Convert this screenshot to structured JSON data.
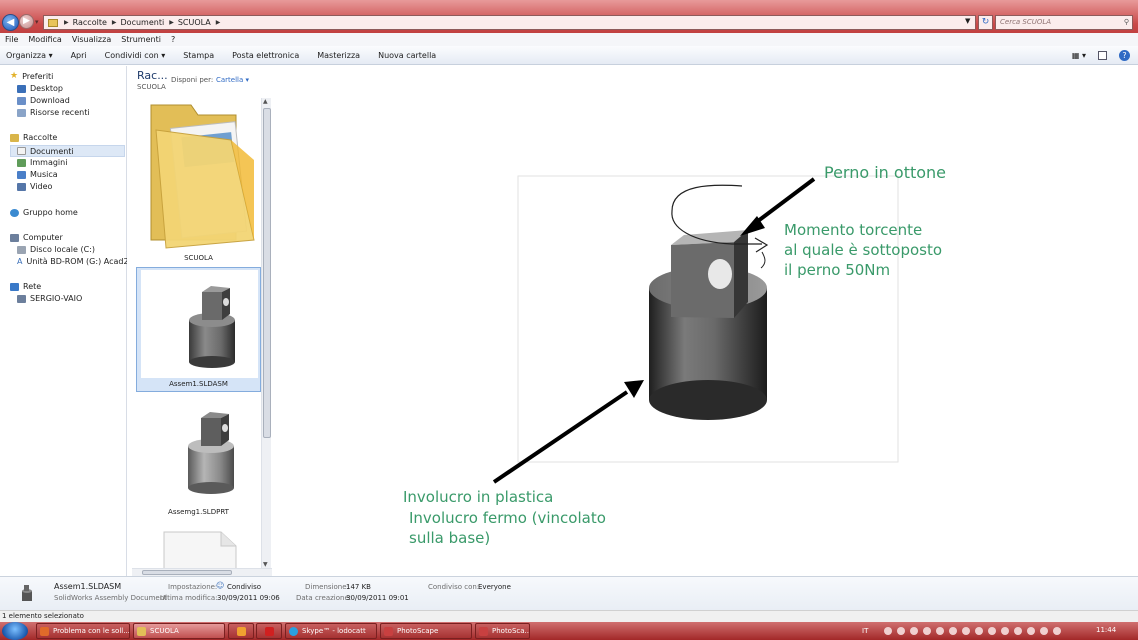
{
  "address": {
    "segments": [
      "Raccolte",
      "Documenti",
      "SCUOLA"
    ],
    "search_placeholder": "Cerca SCUOLA"
  },
  "menu": [
    "File",
    "Modifica",
    "Visualizza",
    "Strumenti",
    "?"
  ],
  "toolbar": [
    "Organizza ▾",
    "Apri",
    "Condividi con ▾",
    "Stampa",
    "Posta elettronica",
    "Masterizza",
    "Nuova cartella"
  ],
  "nav": {
    "favorites": "Preferiti",
    "desktop": "Desktop",
    "download": "Download",
    "recent": "Risorse recenti",
    "libraries": "Raccolte",
    "documents": "Documenti",
    "images": "Immagini",
    "music": "Musica",
    "video": "Video",
    "homegroup": "Gruppo home",
    "computer": "Computer",
    "disk_c": "Disco locale (C:)",
    "bdrom": "Unità BD-ROM (G:) Acad2010",
    "network": "Rete",
    "pc": "SERGIO-VAIO"
  },
  "library": {
    "title": "Rac...",
    "subtitle": "SCUOLA",
    "arrange_label": "Disponi per:",
    "arrange_value": "Cartella ▾"
  },
  "files": [
    {
      "name": "SCUOLA"
    },
    {
      "name": "Assem1.SLDASM"
    },
    {
      "name": "Assemg1.SLDPRT"
    }
  ],
  "preview": {
    "label_pin": "Perno in ottone",
    "label_torque_1": "Momento torcente",
    "label_torque_2": "al quale è sottoposto",
    "label_torque_3": "il perno 50Nm",
    "label_case_1": "Involucro in plastica",
    "label_case_2": "Involucro fermo (vincolato",
    "label_case_3": "sulla base)",
    "text_color": "#3a9a6a"
  },
  "details": {
    "name": "Assem1.SLDASM",
    "type": "SolidWorks Assembly Document",
    "share_state_label": "Impostazione:",
    "share_state_value": "Condiviso",
    "modified_label": "Ultima modifica:",
    "modified_value": "30/09/2011 09:06",
    "size_label": "Dimensione:",
    "size_value": "147 KB",
    "created_label": "Data creazione:",
    "created_value": "30/09/2011 09:01",
    "shared_with_label": "Condiviso con:",
    "shared_with_value": "Everyone"
  },
  "status": "1 elemento selezionato",
  "taskbar": {
    "tasks": [
      "Problema con le soll...",
      "SCUOLA",
      "",
      "",
      "Skype™ - lodocatt",
      "PhotoScape",
      "PhotoSca..."
    ],
    "lang": "IT",
    "time": "11:44"
  }
}
